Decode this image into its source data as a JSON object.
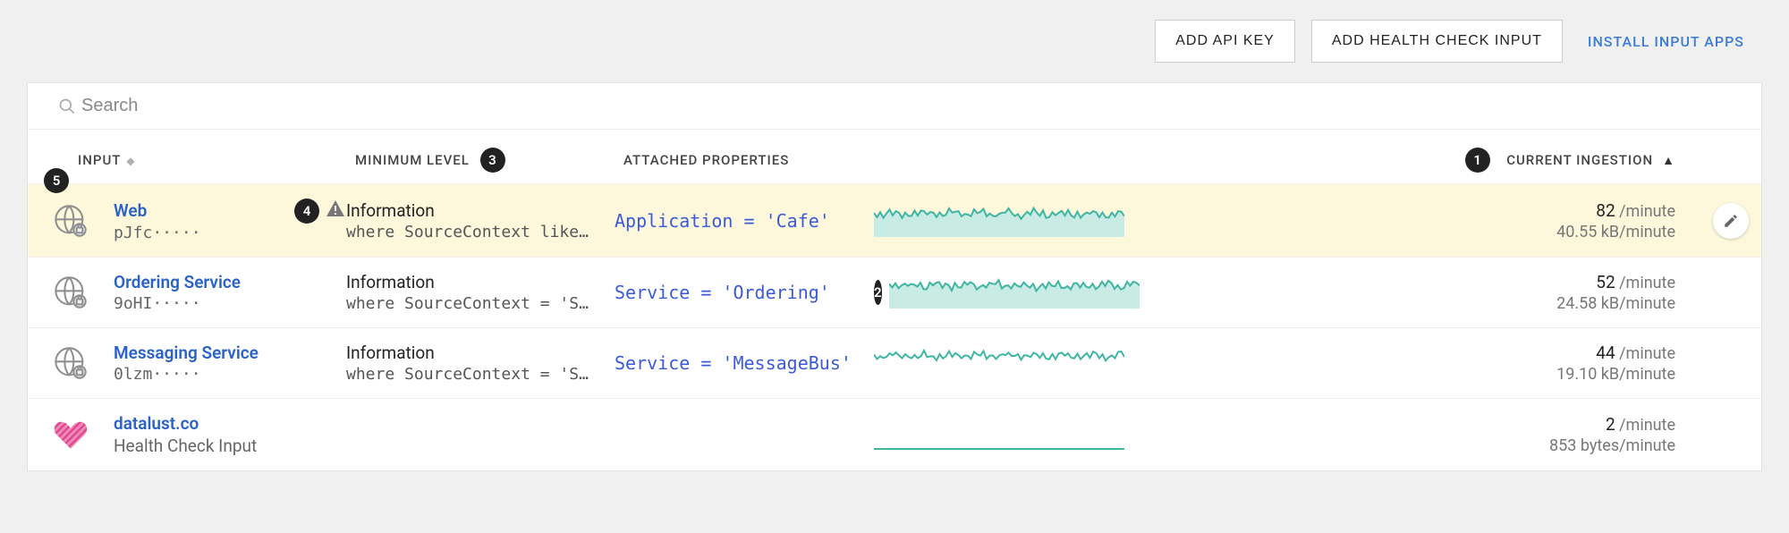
{
  "toolbar": {
    "add_api_key": "ADD API KEY",
    "add_health_check": "ADD HEALTH CHECK INPUT",
    "install_apps": "INSTALL INPUT APPS"
  },
  "search": {
    "placeholder": "Search"
  },
  "headers": {
    "input": "INPUT",
    "minimum_level": "MINIMUM LEVEL",
    "attached_properties": "ATTACHED PROPERTIES",
    "current_ingestion": "CURRENT INGESTION",
    "sort_indicator": "▲"
  },
  "badges": {
    "b1": "1",
    "b2": "2",
    "b3": "3",
    "b4": "4",
    "b5": "5"
  },
  "rows": [
    {
      "name": "Web",
      "key": "pJfc·····",
      "level": "Information",
      "filter": "where SourceContext like '…",
      "props": "Application = 'Cafe'",
      "rate_value": "82",
      "rate_unit": " /minute",
      "kb": "40.55 kB/minute",
      "selected": true,
      "warn": true,
      "spark_fill": true
    },
    {
      "name": "Ordering Service",
      "key": "9oHI·····",
      "level": "Information",
      "filter": "where SourceContext = 'Seq…",
      "props": "Service = 'Ordering'",
      "rate_value": "52",
      "rate_unit": " /minute",
      "kb": "24.58 kB/minute",
      "spark_fill": true,
      "badge2": true
    },
    {
      "name": "Messaging Service",
      "key": "0lzm·····",
      "level": "Information",
      "filter": "where SourceContext = 'Seq…",
      "props": "Service = 'MessageBus'",
      "rate_value": "44",
      "rate_unit": " /minute",
      "kb": "19.10 kB/minute",
      "spark_fill": false
    },
    {
      "name": "datalust.co",
      "subtitle": "Health Check Input",
      "rate_value": "2",
      "rate_unit": " /minute",
      "kb": "853 bytes/minute",
      "heart": true,
      "flat": true
    }
  ]
}
